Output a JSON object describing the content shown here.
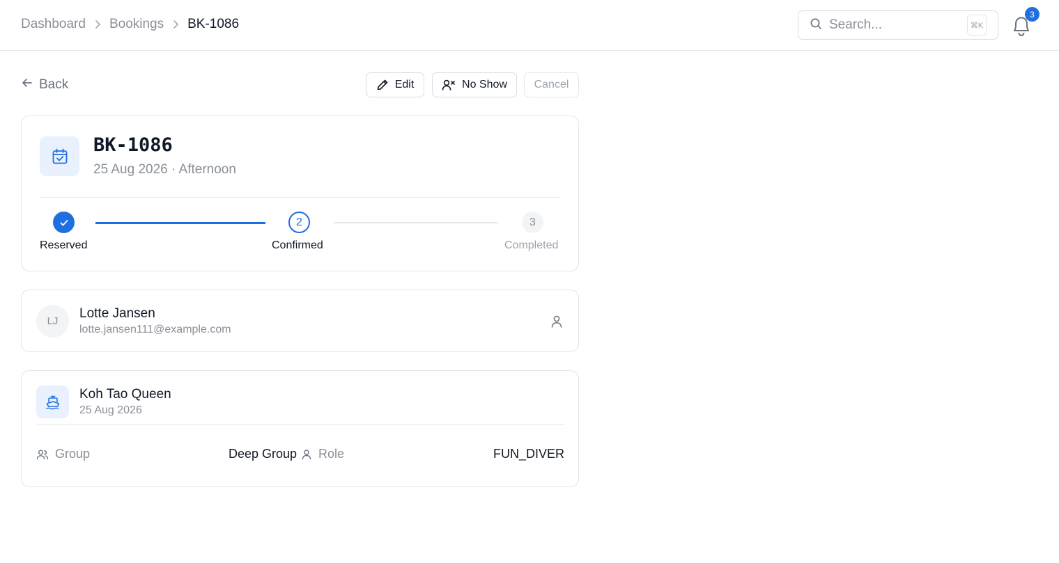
{
  "breadcrumb": {
    "items": [
      "Dashboard",
      "Bookings",
      "BK-1086"
    ]
  },
  "search": {
    "placeholder": "Search...",
    "shortcut": "⌘K"
  },
  "notifications": {
    "count": "3"
  },
  "actions": {
    "back_label": "Back",
    "edit_label": "Edit",
    "no_show_label": "No Show",
    "cancel_label": "Cancel"
  },
  "booking": {
    "id": "BK-1086",
    "subtitle": "25 Aug 2026 · Afternoon",
    "icon": "calendar-check-icon"
  },
  "progress": {
    "steps": [
      {
        "number": "1",
        "label": "Reserved",
        "state": "done"
      },
      {
        "number": "2",
        "label": "Confirmed",
        "state": "active"
      },
      {
        "number": "3",
        "label": "Completed",
        "state": "pending"
      }
    ]
  },
  "customer": {
    "initials": "LJ",
    "name": "Lotte Jansen",
    "email": "lotte.jansen111@example.com"
  },
  "trip": {
    "boat_name": "Koh Tao Queen",
    "date": "25 Aug 2026",
    "group_label": "Group",
    "group_value": "Deep Group",
    "role_label": "Role",
    "role_value": "FUN_DIVER"
  },
  "colors": {
    "accent": "#1f6fe0",
    "muted_text": "#8a8f98",
    "border": "#e3e5e9",
    "icon_bg": "#e8f1fd"
  }
}
